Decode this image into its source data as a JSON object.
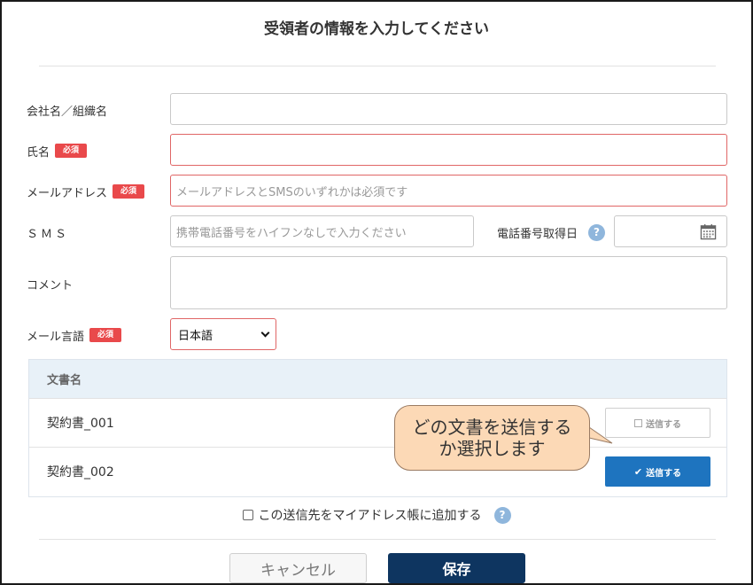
{
  "dialog": {
    "title": "受領者の情報を入力してください"
  },
  "form": {
    "company": {
      "label": "会社名／組織名",
      "value": ""
    },
    "name": {
      "label": "氏名",
      "required_badge": "必須",
      "value": ""
    },
    "email": {
      "label": "メールアドレス",
      "required_badge": "必須",
      "placeholder": "メールアドレスとSMSのいずれかは必須です"
    },
    "sms": {
      "label": "ＳＭＳ",
      "placeholder": "携帯電話番号をハイフンなしで入力ください"
    },
    "phone_date": {
      "label": "電話番号取得日",
      "help": "?",
      "value": ""
    },
    "comment": {
      "label": "コメント",
      "value": ""
    },
    "mail_language": {
      "label": "メール言語",
      "required_badge": "必須",
      "selected": "日本語"
    }
  },
  "documents": {
    "header": "文書名",
    "rows": [
      {
        "name": "契約書_001",
        "action_label": "送信する",
        "selected": false
      },
      {
        "name": "契約書_002",
        "action_label": "送信する",
        "selected": true
      }
    ]
  },
  "callout": {
    "text": "どの文書を送信するか選択します"
  },
  "address_book": {
    "label": "この送信先をマイアドレス帳に追加する",
    "help": "?",
    "checked": false
  },
  "footer": {
    "cancel_label": "キャンセル",
    "save_label": "保存"
  },
  "colors": {
    "required": "#e9494b",
    "primary": "#1e74bf",
    "save": "#0e3560",
    "callout": "#fcd9b6"
  }
}
